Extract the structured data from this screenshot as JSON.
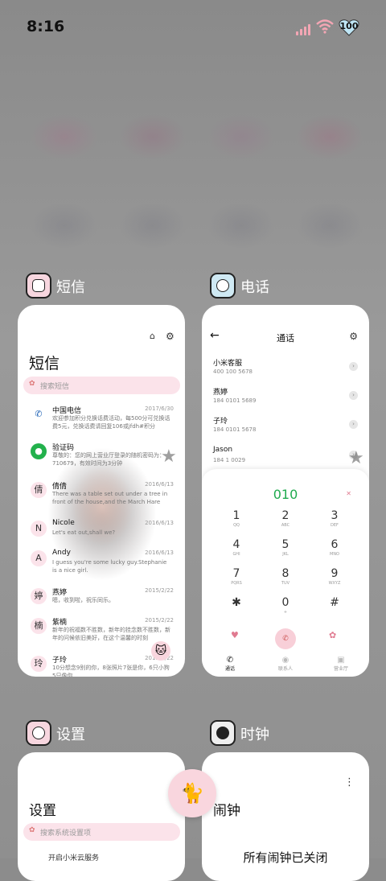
{
  "status": {
    "time": "8:16",
    "battery": "100"
  },
  "cards": {
    "sms": {
      "app_name": "短信",
      "title": "短信",
      "search_placeholder": "搜索短信",
      "messages": [
        {
          "avatar": "✆",
          "name": "中国电信",
          "date": "2017/6/30",
          "preview": "欢迎参加积分兑换话费活动，每500分可兑换话费5元，兑换话费请回复106或jfdh#积分"
        },
        {
          "avatar": "●",
          "name": "验证码",
          "date": "",
          "preview": "尊敬的：您的网上营业厅登录的随机密码为：710679，有效时间为3分钟"
        },
        {
          "avatar": "倩",
          "name": "倩倩",
          "date": "2016/6/13",
          "preview": "There was a table set out under a tree in front of the house,and the March Hare an..."
        },
        {
          "avatar": "N",
          "name": "Nicole",
          "date": "2016/6/13",
          "preview": "Let's eat out,shall we?"
        },
        {
          "avatar": "A",
          "name": "Andy",
          "date": "2016/6/13",
          "preview": "I guess you're some lucky guy.Stephanie is a nice girl."
        },
        {
          "avatar": "婷",
          "name": "燕婷",
          "date": "2015/2/22",
          "preview": "嗯，收到啦，祝乐同乐。"
        },
        {
          "avatar": "楠",
          "name": "紫楠",
          "date": "2015/2/22",
          "preview": "新年的祝福数不胜数，新年的挂念数不胜数，新年的问候依旧美好，在这个温馨的时刻"
        },
        {
          "avatar": "玲",
          "name": "子玲",
          "date": "2015/2/22",
          "preview": "10分想念9别的你，8张照片7张是你，6只小狗5只像你"
        }
      ]
    },
    "phone": {
      "app_name": "电话",
      "title": "通话",
      "contacts": [
        {
          "name": "小米客服",
          "number": "400 100 5678"
        },
        {
          "name": "燕婷",
          "number": "184 0101 5689"
        },
        {
          "name": "子玲",
          "number": "184 0101 5678"
        },
        {
          "name": "Jason",
          "number": "184 1 0029"
        }
      ],
      "dial_display": "010",
      "keys": [
        {
          "d": "1",
          "l": "QQ"
        },
        {
          "d": "2",
          "l": "ABC"
        },
        {
          "d": "3",
          "l": "DEF"
        },
        {
          "d": "4",
          "l": "GHI"
        },
        {
          "d": "5",
          "l": "JKL"
        },
        {
          "d": "6",
          "l": "MNO"
        },
        {
          "d": "7",
          "l": "PQRS"
        },
        {
          "d": "8",
          "l": "TUV"
        },
        {
          "d": "9",
          "l": "WXYZ"
        },
        {
          "d": "✱",
          "l": ""
        },
        {
          "d": "0",
          "l": "+"
        },
        {
          "d": "#",
          "l": ""
        }
      ],
      "tabs": [
        "通话",
        "联系人",
        "营业厅"
      ]
    },
    "settings": {
      "app_name": "设置",
      "title": "设置",
      "search_placeholder": "搜索系统设置项",
      "first_row": "开启小米云服务"
    },
    "clock": {
      "app_name": "时钟",
      "title": "闹钟",
      "empty_text": "所有闹钟已关闭"
    }
  },
  "colors": {
    "accent_pink": "#f9d6de",
    "dial_green": "#1faa4e"
  },
  "icons": {
    "float_button": "cat-icon"
  }
}
